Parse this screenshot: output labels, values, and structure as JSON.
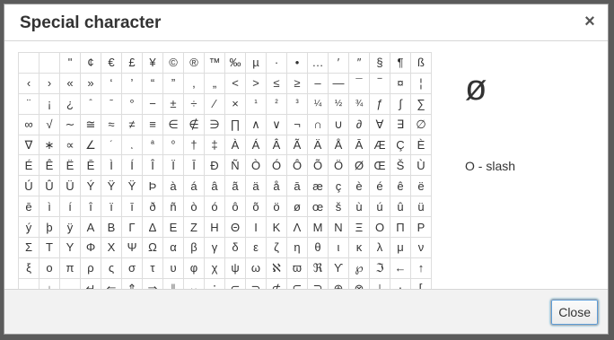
{
  "dialog": {
    "title": "Special character",
    "close_icon": "×",
    "close_button_label": "Close"
  },
  "preview": {
    "glyph": "ø",
    "name": "O - slash"
  },
  "characters": [
    " ",
    " ",
    "\"",
    "¢",
    "€",
    "£",
    "¥",
    "©",
    "®",
    "™",
    "‰",
    "µ",
    "·",
    "•",
    "…",
    "′",
    "″",
    "§",
    "¶",
    "ß",
    "‹",
    "›",
    "«",
    "»",
    "‘",
    "’",
    "“",
    "”",
    "‚",
    "„",
    "<",
    ">",
    "≤",
    "≥",
    "–",
    "—",
    "¯",
    "‾",
    "¤",
    "¦",
    "¨",
    "¡",
    "¿",
    "ˆ",
    "˜",
    "°",
    "−",
    "±",
    "÷",
    "⁄",
    "×",
    "¹",
    "²",
    "³",
    "¼",
    "½",
    "¾",
    "ƒ",
    "∫",
    "∑",
    "∞",
    "√",
    "∼",
    "≅",
    "≈",
    "≠",
    "≡",
    "∈",
    "∉",
    "∋",
    "∏",
    "∧",
    "∨",
    "¬",
    "∩",
    "∪",
    "∂",
    "∀",
    "∃",
    "∅",
    "∇",
    "∗",
    "∝",
    "∠",
    "´",
    "¸",
    "ª",
    "º",
    "†",
    "‡",
    "À",
    "Á",
    "Â",
    "Ã",
    "Ä",
    "Å",
    "Ā",
    "Æ",
    "Ç",
    "È",
    "É",
    "Ê",
    "Ë",
    "Ē",
    "Ì",
    "Í",
    "Î",
    "Ï",
    "Ī",
    "Ð",
    "Ñ",
    "Ò",
    "Ó",
    "Ô",
    "Õ",
    "Ö",
    "Ø",
    "Œ",
    "Š",
    "Ù",
    "Ú",
    "Û",
    "Ü",
    "Ý",
    "Ÿ",
    "Ÿ",
    "Þ",
    "à",
    "á",
    "â",
    "ã",
    "ä",
    "å",
    "ā",
    "æ",
    "ç",
    "è",
    "é",
    "ê",
    "ë",
    "ē",
    "ì",
    "í",
    "î",
    "ï",
    "ī",
    "ð",
    "ñ",
    "ò",
    "ó",
    "ô",
    "õ",
    "ö",
    "ø",
    "œ",
    "š",
    "ù",
    "ú",
    "û",
    "ü",
    "ý",
    "þ",
    "ÿ",
    "Α",
    "Β",
    "Γ",
    "Δ",
    "Ε",
    "Ζ",
    "Η",
    "Θ",
    "Ι",
    "Κ",
    "Λ",
    "Μ",
    "Ν",
    "Ξ",
    "Ο",
    "Π",
    "Ρ",
    "Σ",
    "Τ",
    "Υ",
    "Φ",
    "Χ",
    "Ψ",
    "Ω",
    "α",
    "β",
    "γ",
    "δ",
    "ε",
    "ζ",
    "η",
    "θ",
    "ι",
    "κ",
    "λ",
    "μ",
    "ν",
    "ξ",
    "ο",
    "π",
    "ρ",
    "ς",
    "σ",
    "τ",
    "υ",
    "φ",
    "χ",
    "ψ",
    "ω",
    "ℵ",
    "ϖ",
    "ℜ",
    "ϒ",
    "℘",
    "ℑ",
    "←",
    "↑",
    "→",
    "↓",
    "↔",
    "↵",
    "⇐",
    "⇑",
    "⇒",
    "⇓",
    "⇔",
    "∴",
    "⊂",
    "⊃",
    "⊄",
    "⊆",
    "⊇",
    "⊕",
    "⊗",
    "⊥",
    "⋅",
    "⌈",
    "⌉",
    "⌊",
    "⌋",
    "〈",
    "〉",
    "◊",
    "♠",
    "♣",
    "♥",
    "♦",
    "",
    "",
    "",
    "",
    "",
    "",
    "",
    "",
    "",
    ""
  ]
}
